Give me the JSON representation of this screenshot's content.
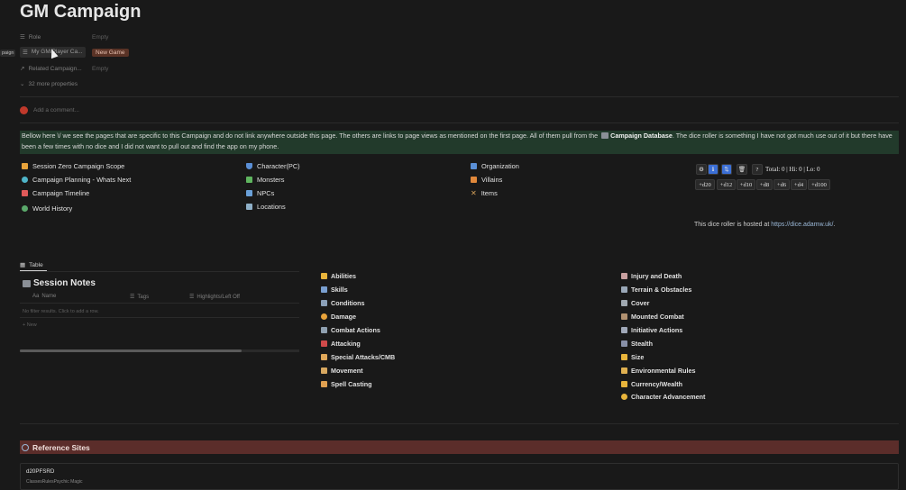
{
  "page": {
    "title": "GM Campaign"
  },
  "properties": [
    {
      "key": "Role",
      "value": "Empty"
    },
    {
      "key": "My GM/Player Ca...",
      "value": "New Game"
    },
    {
      "key": "Related Campaign...",
      "value": "Empty"
    },
    {
      "key": "32 more properties",
      "value": ""
    }
  ],
  "sidebar_tooltip": "paign",
  "comment": {
    "placeholder": "Add a comment..."
  },
  "callout": {
    "text_before": "Bellow here \\/ we see the pages that are specific to this Campaign and do not link anywhere outside this page. The others are links to page views as mentioned on the first page. All of them pull from the ",
    "link": "Campaign Database",
    "text_after": ". The dice roller is something I have not got much use out of it but there have been a few times with no dice and I did not want to pull out and find the app on my phone."
  },
  "links_col1": [
    {
      "label": "Session Zero Campaign Scope",
      "icon": "orange-book-icon",
      "color": "#e8a33b"
    },
    {
      "label": "Campaign Planning - Whats Next",
      "icon": "globe-icon",
      "color": "#4fb5c9"
    },
    {
      "label": "Campaign Timeline",
      "icon": "calendar-icon",
      "color": "#e05a5a"
    },
    {
      "label": "World History",
      "icon": "earth-icon",
      "color": "#5aa86a"
    }
  ],
  "links_col2": [
    {
      "label": "Character(PC)",
      "icon": "shield-icon",
      "color": "#5a8fd6"
    },
    {
      "label": "Monsters",
      "icon": "dragon-icon",
      "color": "#5fb55f"
    },
    {
      "label": "NPCs",
      "icon": "people-icon",
      "color": "#6aa0d8"
    },
    {
      "label": "Locations",
      "icon": "map-icon",
      "color": "#8fb0c8"
    }
  ],
  "links_col3": [
    {
      "label": "Organization",
      "icon": "org-icon",
      "color": "#5a8fd6"
    },
    {
      "label": "Villains",
      "icon": "villain-icon",
      "color": "#e0883b"
    },
    {
      "label": "Items",
      "icon": "swords-icon",
      "color": "#d4a05a"
    }
  ],
  "dice": {
    "top_buttons": [
      "⚙",
      "ℹ",
      "⇅",
      "🗑",
      "?"
    ],
    "total_text": "Total: 0 | Hi: 0 | Lo: 0",
    "dice_buttons": [
      "+d20",
      "+d12",
      "+d10",
      "+d8",
      "+d6",
      "+d4",
      "+d100"
    ],
    "hosted_prefix": "This dice roller is hosted at ",
    "hosted_link": "https://dice.adamw.uk/",
    "hosted_suffix": "."
  },
  "table_tab": "Table",
  "session_notes": {
    "title": "Session Notes",
    "columns": [
      "Name",
      "Tags",
      "Highlights/Left Off"
    ],
    "column_prefix": "Aa",
    "empty_message": "No filter results. Click to add a row.",
    "new_label": "New"
  },
  "rules_col1": [
    "Abilities",
    "Skills",
    "Conditions",
    "Damage",
    "Combat Actions",
    "Attacking",
    "Special Attacks/CMB",
    "Movement",
    "Spell Casting"
  ],
  "rules_col2": [
    "Injury and Death",
    "Terrain & Obstacles",
    "Cover",
    "Mounted Combat",
    "Initiative Actions",
    "Stealth",
    "Size",
    "Environmental Rules",
    "Currency/Wealth",
    "Character Advancement"
  ],
  "reference": {
    "header": "Reference Sites",
    "site_name": "d20PFSRD",
    "site_sub": "ClassesRulesPsychic Magic"
  },
  "colors": {
    "background": "#191919",
    "callout_bg": "#223a2b",
    "reference_bg": "#5b2d2a",
    "tag_new_bg": "#5a3326"
  }
}
